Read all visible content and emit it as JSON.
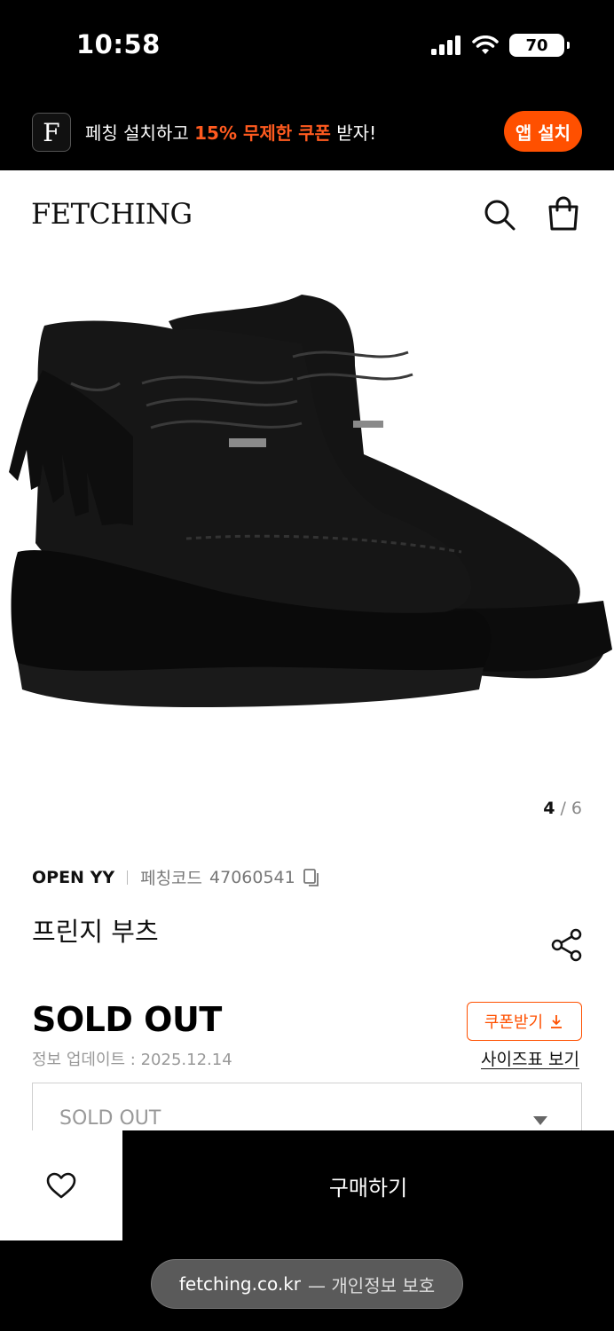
{
  "status_bar": {
    "time": "10:58",
    "battery": "70",
    "icons": [
      "signal-icon",
      "wifi-icon",
      "battery-icon"
    ]
  },
  "promo": {
    "logo_letter": "F",
    "text_pre": "페칭 설치하고 ",
    "text_highlight": "15% 무제한 쿠폰",
    "text_post": " 받자!",
    "install_label": "앱 설치",
    "accent_color": "#ff5000"
  },
  "header": {
    "brand": "FETCHING",
    "icons": [
      "search-icon",
      "shopping-bag-icon"
    ]
  },
  "gallery": {
    "current": "4",
    "separator": " / ",
    "total": "6"
  },
  "product": {
    "brand": "OPEN YY",
    "code_label": "페칭코드",
    "code_value": "47060541",
    "title": "프린지 부츠",
    "price": "SOLD OUT",
    "updated": "정보 업데이트 : 2025.12.14",
    "coupon_label": "쿠폰받기",
    "size_chart_label": "사이즈표 보기"
  },
  "option": {
    "selected": "SOLD OUT"
  },
  "bottom_bar": {
    "buy_label": "구매하기"
  },
  "browser": {
    "domain": "fetching.co.kr",
    "privacy": "— 개인정보 보호"
  }
}
